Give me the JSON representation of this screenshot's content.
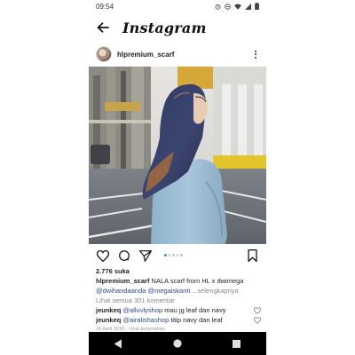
{
  "status": {
    "time": "09:54"
  },
  "app": {
    "title": "Instagram"
  },
  "post": {
    "username": "hlpremium_scarf",
    "likes": "2.776 suka",
    "caption_user": "hlpremium_scarf",
    "caption_text": " NALA scarf from HL x dwimega",
    "caption_mentions": "@dwihandaanda @megaiskanti",
    "caption_more": "... selengkapnya",
    "view_all": "Lihat semua 301 komentar",
    "carousel_count": 5,
    "carousel_active": 0
  },
  "comments": [
    {
      "user": "jeunkeq",
      "mention": "@alluvlyshop",
      "text": " mau jg leaf dan navy"
    },
    {
      "user": "jeunkeq",
      "mention": "@airalishashop",
      "text": " titip navy dan leaf"
    }
  ],
  "timestamp": "16 April 2018 · Lihat terjemahan",
  "icons": {
    "back": "back-arrow-icon",
    "more": "more-vertical-icon",
    "like": "heart-icon",
    "comment": "comment-icon",
    "share": "send-icon",
    "save": "bookmark-icon"
  },
  "colors": {
    "mention": "#2b4a83",
    "carousel_active": "#3897f0"
  }
}
